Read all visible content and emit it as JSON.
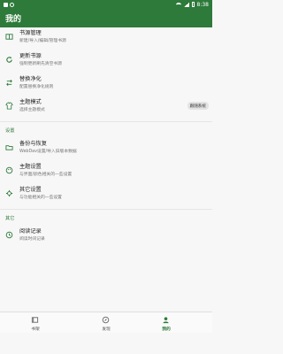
{
  "status_bar": {
    "time": "8:38"
  },
  "app_bar": {
    "title": "我的"
  },
  "items": [
    {
      "title": "书源管理",
      "subtitle": "新建/导入/编辑/管理书源",
      "icon": "book-management-icon"
    },
    {
      "title": "更新书源",
      "subtitle": "强制更新刷先清空书源",
      "icon": "refresh-icon"
    },
    {
      "title": "替换净化",
      "subtitle": "配置替换净化规则",
      "icon": "swap-icon"
    },
    {
      "title": "主题模式",
      "subtitle": "选择主题模式",
      "icon": "shirt-icon",
      "badge": "跟随系统"
    }
  ],
  "section_settings": {
    "label": "设置",
    "items": [
      {
        "title": "备份与恢复",
        "subtitle": "WebDav设置/导入旧版本数据",
        "icon": "folder-icon"
      },
      {
        "title": "主题设置",
        "subtitle": "与界面/颜色相关的一些设置",
        "icon": "palette-icon"
      },
      {
        "title": "其它设置",
        "subtitle": "与功能相关的一些设置",
        "icon": "gear-icon"
      }
    ]
  },
  "section_other": {
    "label": "其它",
    "items": [
      {
        "title": "阅读记录",
        "subtitle": "阅读时间记录",
        "icon": "clock-icon"
      }
    ]
  },
  "bottom_nav": [
    {
      "label": "书架",
      "icon": "bookshelf-icon"
    },
    {
      "label": "发现",
      "icon": "compass-icon"
    },
    {
      "label": "我的",
      "icon": "person-icon"
    }
  ],
  "colors": {
    "primary": "#2d7a3a",
    "background": "#f7f7f7"
  }
}
